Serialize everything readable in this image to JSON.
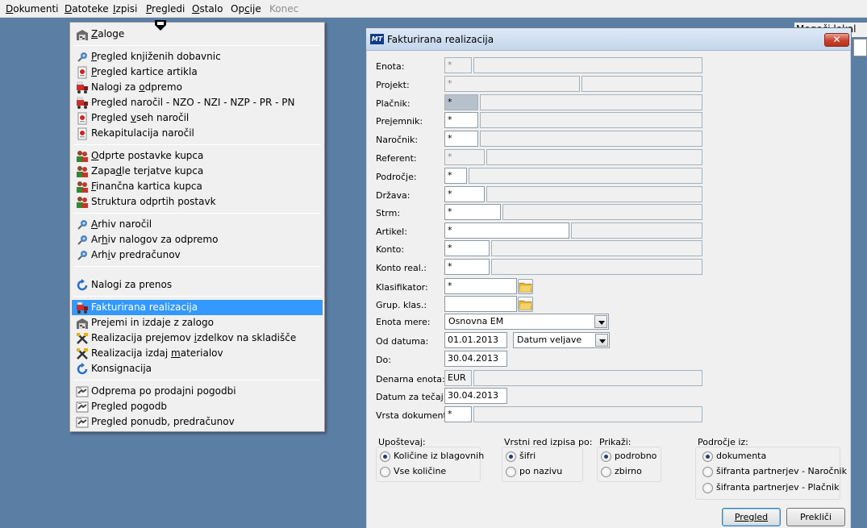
{
  "menubar": {
    "items": [
      {
        "label": "Dokumenti",
        "accel": "D",
        "rest": "okumenti",
        "disabled": false
      },
      {
        "label": "Datoteke",
        "accel": "D",
        "rest": "atoteke",
        "disabled": false
      },
      {
        "label": "Izpisi",
        "accel": "I",
        "rest": "zpisi",
        "disabled": false
      },
      {
        "label": "Pregledi",
        "accel": "P",
        "rest": "regledi",
        "disabled": false
      },
      {
        "label": "Ostalo",
        "accel": "O",
        "rest": "stalo",
        "disabled": false
      },
      {
        "label": "Opcije",
        "pre": "Op",
        "accel": "c",
        "rest": "ije",
        "disabled": false
      },
      {
        "label": "Konec",
        "disabled": true
      }
    ],
    "background_fragment": "Mogoči lokal"
  },
  "dropdown": {
    "items": [
      {
        "label": "Zaloge",
        "pre": "",
        "accel": "Z",
        "post": "aloge",
        "icon": "warehouse-icon"
      },
      {
        "label": "Pregled knjiženih dobavnic",
        "pre": "",
        "accel": "P",
        "post": "regled knjiženih dobavnic",
        "icon": "pin-icon"
      },
      {
        "label": "Pregled kartice artikla",
        "pre": "",
        "accel": "P",
        "post": "regled kartice artikla",
        "icon": "card-icon"
      },
      {
        "label": "Nalogi za odpremo",
        "pre": "Nalogi za ",
        "accel": "o",
        "post": "dpremo",
        "icon": "truck-icon"
      },
      {
        "label": "Pregled naročil - NZO - NZI - NZP - PR - PN",
        "pre": "Pregled naročil - NZO - NZI - NZP - PR - PN",
        "accel": "",
        "post": "",
        "icon": "truck-icon"
      },
      {
        "label": "Pregled vseh naročil",
        "pre": "Pregled ",
        "accel": "v",
        "post": "seh naročil",
        "icon": "card-icon"
      },
      {
        "label": "Rekapitulacija naročil",
        "pre": "Rekapitulacija naročil",
        "accel": "",
        "post": "",
        "icon": "card-icon"
      },
      {
        "label": "Odprte postavke kupca",
        "pre": "",
        "accel": "O",
        "post": "dprte postavke kupca",
        "icon": "users-icon"
      },
      {
        "label": "Zapadle terjatve kupca",
        "pre": "Zapa",
        "accel": "d",
        "post": "le terjatve kupca",
        "icon": "users-icon"
      },
      {
        "label": "Finančna kartica kupca",
        "pre": "",
        "accel": "F",
        "post": "inančna kartica kupca",
        "icon": "users-icon"
      },
      {
        "label": "Struktura odprtih postavk",
        "pre": "Struktura odprtih postavk",
        "accel": "",
        "post": "",
        "icon": "users-icon"
      },
      {
        "label": "Arhiv naročil",
        "pre": "",
        "accel": "A",
        "post": "rhiv naročil",
        "icon": "pin-icon"
      },
      {
        "label": "Arhiv nalogov za odpremo",
        "pre": "Ar",
        "accel": "h",
        "post": "iv nalogov za odpremo",
        "icon": "pin-icon"
      },
      {
        "label": "Arhiv predračunov",
        "pre": "Arh",
        "accel": "i",
        "post": "v predračunov",
        "icon": "pin-icon"
      },
      {
        "label": "Nalogi za prenos",
        "pre": "Nalogi za prenos",
        "accel": "",
        "post": "",
        "icon": "refresh-icon"
      },
      {
        "label": "Fakturirana realizacija",
        "pre": "Fakturirana realizacija",
        "accel": "",
        "post": "",
        "icon": "truck-icon"
      },
      {
        "label": "Prejemi in izdaje z zalogo",
        "pre": "Prejemi in izdaje z zalogo",
        "accel": "",
        "post": "",
        "icon": "warehouse-icon"
      },
      {
        "label": "Realizacija prejemov izdelkov na skladišče",
        "pre": "Realizacija prejemov ",
        "accel": "i",
        "post": "zdelkov na skladišče",
        "icon": "tools-icon"
      },
      {
        "label": "Realizacija izdaj materialov",
        "pre": "Realizacija izdaj ",
        "accel": "m",
        "post": "aterialov",
        "icon": "tools-icon"
      },
      {
        "label": "Konsignacija",
        "pre": "Konsignacija",
        "accel": "",
        "post": "",
        "icon": "refresh-icon"
      },
      {
        "label": "Odprema po prodajni pogodbi",
        "pre": "Odprema po prodajni pogodbi",
        "accel": "",
        "post": "",
        "icon": "handshake-icon"
      },
      {
        "label": "Pregled pogodb",
        "pre": "Pregled pogodb",
        "accel": "",
        "post": "",
        "icon": "handshake-icon"
      },
      {
        "label": "Pregled ponudb, predračunov",
        "pre": "Pregled ponudb, predračunov",
        "accel": "",
        "post": "",
        "icon": "handshake-icon"
      }
    ],
    "selected_label": "Fakturirana realizacija"
  },
  "dialog": {
    "title": "Fakturirana realizacija",
    "app_icon_text": "MT",
    "fields": {
      "enota": {
        "label": "Enota:",
        "value": "*"
      },
      "projekt": {
        "label": "Projekt:",
        "value": "*"
      },
      "placnik": {
        "label": "Plačnik:",
        "value": "*"
      },
      "prejemnik": {
        "label": "Prejemnik:",
        "value": "*"
      },
      "narocnik": {
        "label": "Naročnik:",
        "value": "*"
      },
      "referent": {
        "label": "Referent:",
        "value": "*"
      },
      "podrocje": {
        "label": "Področje:",
        "value": "*"
      },
      "drzava": {
        "label": "Država:",
        "value": "*"
      },
      "strm": {
        "label": "Strm:",
        "value": "*"
      },
      "artikel": {
        "label": "Artikel:",
        "value": "*"
      },
      "konto": {
        "label": "Konto:",
        "value": "*"
      },
      "konto_real": {
        "label": "Konto real.:",
        "value": "*"
      },
      "klasifikator": {
        "label": "Klasifikator:",
        "value": "*"
      },
      "grup_klas": {
        "label": "Grup. klas.:",
        "value": ""
      },
      "enota_mere": {
        "label": "Enota mere:",
        "value": "Osnovna EM"
      },
      "od_datuma": {
        "label": "Od datuma:",
        "value": "01.01.2013",
        "type": "Datum veljave"
      },
      "do": {
        "label": "Do:",
        "value": "30.04.2013"
      },
      "denarna_enota": {
        "label": "Denarna enota:",
        "value": "EUR"
      },
      "datum_tecaj": {
        "label": "Datum za tečaj:",
        "value": "30.04.2013"
      },
      "vrsta_dokumenta": {
        "label": "Vrsta dokumenta:",
        "value": "*"
      }
    },
    "groups": {
      "upostevaj": {
        "label": "Upoštevaj:",
        "options": [
          "Količine iz blagovnih",
          "Vse količine"
        ],
        "selected": 0
      },
      "vrstni_red": {
        "label": "Vrstni red izpisa po:",
        "options": [
          "šifri",
          "po nazivu"
        ],
        "selected": 0
      },
      "prikazi": {
        "label": "Prikaži:",
        "options": [
          "podrobno",
          "zbirno"
        ],
        "selected": 0
      },
      "podrocje_iz": {
        "label": "Področje iz:",
        "options": [
          "dokumenta",
          "šifranta partnerjev - Naročnik",
          "šifranta partnerjev - Plačnik"
        ],
        "selected": 0
      }
    },
    "buttons": {
      "pregled": "Pregled",
      "preklici": "Prekliči"
    }
  }
}
